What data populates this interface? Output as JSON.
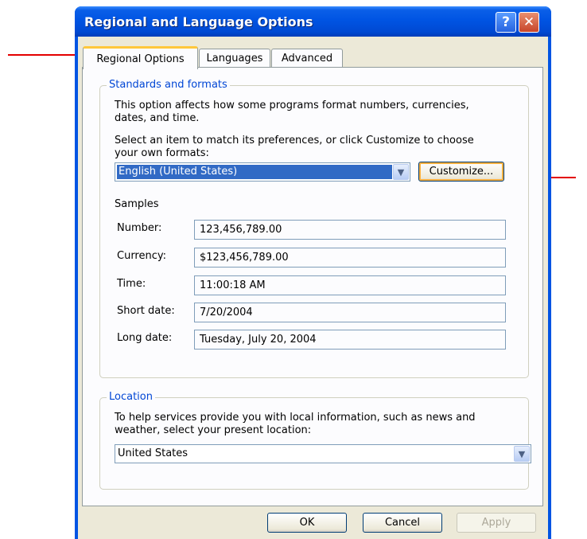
{
  "window": {
    "title": "Regional and Language Options",
    "help_glyph": "?",
    "close_glyph": "✕"
  },
  "tabs": [
    {
      "label": "Regional Options",
      "active": true
    },
    {
      "label": "Languages",
      "active": false
    },
    {
      "label": "Advanced",
      "active": false
    }
  ],
  "standards": {
    "legend": "Standards and formats",
    "desc1": "This option affects how some programs format numbers, currencies,",
    "desc2": "dates, and time.",
    "select1": "Select an item to match its preferences, or click Customize to choose",
    "select2": "your own formats:",
    "format_value": "English (United States)",
    "customize_label": "Customize...",
    "samples_heading": "Samples",
    "samples": [
      {
        "label": "Number:",
        "value": "123,456,789.00"
      },
      {
        "label": "Currency:",
        "value": "$123,456,789.00"
      },
      {
        "label": "Time:",
        "value": "11:00:18 AM"
      },
      {
        "label": "Short date:",
        "value": "7/20/2004"
      },
      {
        "label": "Long date:",
        "value": "Tuesday, July 20, 2004"
      }
    ]
  },
  "location": {
    "legend": "Location",
    "desc1": "To help services provide you with local information, such as news and",
    "desc2": "weather, select your present location:",
    "value": "United States"
  },
  "buttons": {
    "ok": "OK",
    "cancel": "Cancel",
    "apply": "Apply"
  },
  "colors": {
    "annotation_arrow": "#e30000",
    "title_bar": "#0054e3",
    "tab_highlight": "#ffc83c"
  }
}
